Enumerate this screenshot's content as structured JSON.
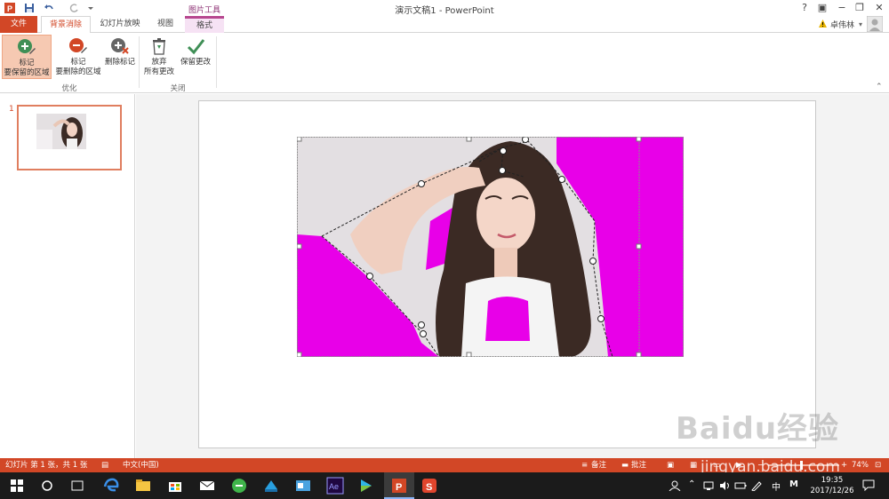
{
  "titlebar": {
    "title": "演示文稿1 - PowerPoint",
    "help": "?",
    "minimize": "−",
    "restore": "❐",
    "close": "✕"
  },
  "tabs": {
    "file": "文件",
    "background_removal": "背景消除",
    "slideshow": "幻灯片放映",
    "view": "视图",
    "context_group": "图片工具",
    "format": "格式"
  },
  "user": {
    "name": "卓伟林"
  },
  "ribbon": {
    "mark_keep_1": "标记",
    "mark_keep_2": "要保留的区域",
    "mark_remove_1": "标记",
    "mark_remove_2": "要删除的区域",
    "delete_mark": "删除标记",
    "discard_1": "放弃",
    "discard_2": "所有更改",
    "keep_changes": "保留更改",
    "group_refine": "优化",
    "group_close": "关闭"
  },
  "thumbnails": [
    {
      "number": "1"
    }
  ],
  "statusbar": {
    "slide_info": "幻灯片 第 1 张，共 1 张",
    "language": "中文(中国)",
    "notes": "备注",
    "comments": "批注",
    "zoom": "74%"
  },
  "taskbar": {
    "time": "19:35",
    "date": "2017/12/26",
    "ime": "中",
    "ime2": "M"
  },
  "watermark": {
    "text": "Baidu经验",
    "url": "jingyan.baidu.com"
  },
  "colors": {
    "accent": "#d24726",
    "removal_magenta": "#e800e8"
  }
}
